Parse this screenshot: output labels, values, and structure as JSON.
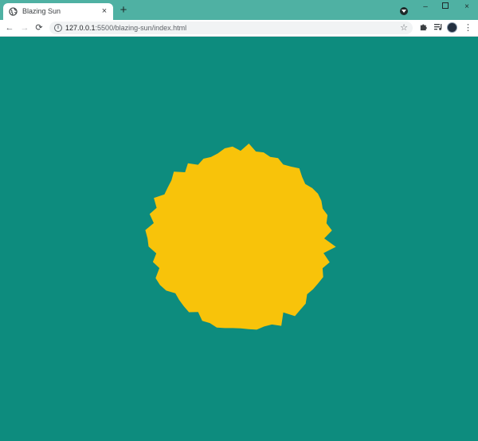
{
  "browser": {
    "tab": {
      "title": "Blazing Sun",
      "close_label": "×",
      "favicon": "globe-icon"
    },
    "new_tab_label": "+",
    "window_controls": {
      "minimize": "–",
      "close": "×"
    },
    "toolbar": {
      "back": "←",
      "forward": "→",
      "reload": "⟳"
    },
    "address": {
      "host": "127.0.0.1",
      "path": ":5500/blazing-sun/index.html"
    },
    "icons": {
      "info": "info-icon",
      "star": "star-icon",
      "extensions": "puzzle-icon",
      "media": "media-control-icon",
      "menu": "kebab-menu-icon"
    }
  },
  "page": {
    "background_color": "#0d8c7e",
    "sun_color": "#f8c30a"
  }
}
